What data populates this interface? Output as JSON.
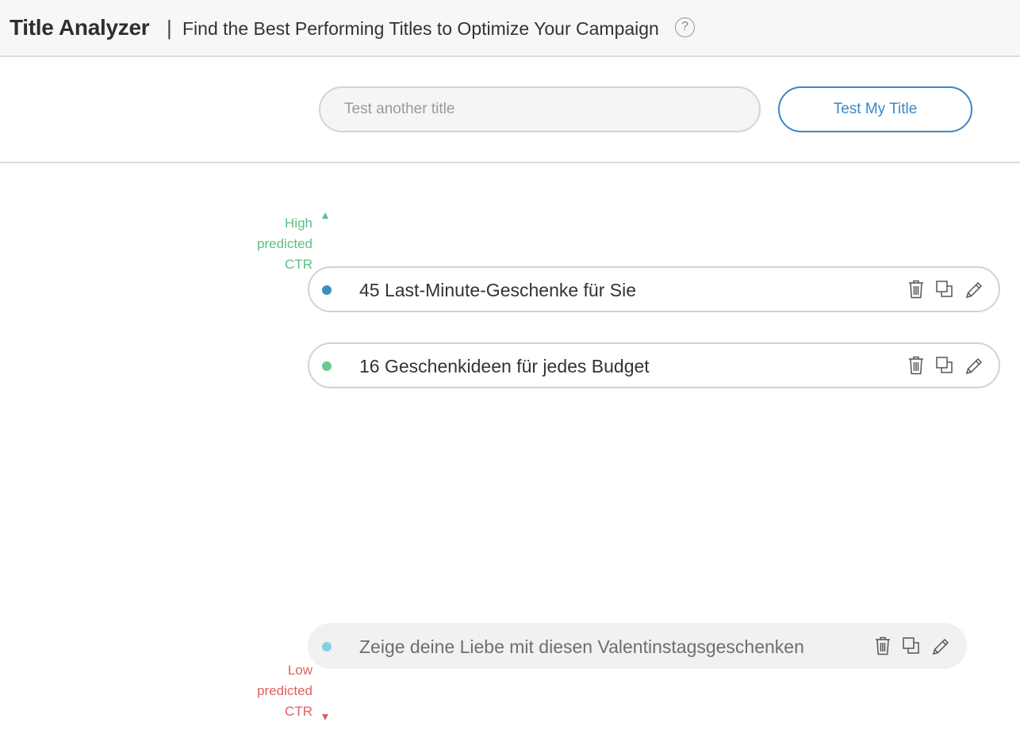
{
  "header": {
    "app_title": "Title Analyzer",
    "separator": "|",
    "subtitle": "Find the Best Performing Titles to Optimize Your Campaign",
    "help_icon": "?"
  },
  "search": {
    "placeholder": "Test another title",
    "value": "",
    "button_label": "Test My Title"
  },
  "axis": {
    "high_label": [
      "High",
      "predicted",
      "CTR"
    ],
    "low_label": [
      "Low",
      "predicted",
      "CTR"
    ],
    "high_color": "#5cbf86",
    "low_color": "#e06060"
  },
  "titles": [
    {
      "text": "45 Last-Minute-Geschenke für Sie",
      "dot_color": "#3d8cc6",
      "state": "normal"
    },
    {
      "text": "16 Geschenkideen für jedes Budget",
      "dot_color": "#6cc98f",
      "state": "normal"
    },
    {
      "text": "Zeige deine Liebe mit diesen Valentinstagsgeschenken",
      "dot_color": "#7fd3de",
      "state": "faded"
    }
  ],
  "icons": [
    "trash-icon",
    "duplicate-icon",
    "edit-pencil-icon"
  ]
}
